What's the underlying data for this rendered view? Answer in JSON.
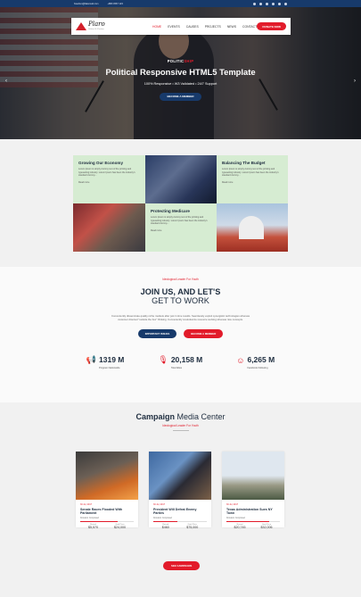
{
  "topbar": {
    "email": "freedom@fakemail.com",
    "phone": "+880 4567 123",
    "social_icons": [
      "facebook-icon",
      "twitter-icon",
      "google-plus-icon",
      "linkedin-icon",
      "instagram-icon",
      "youtube-icon"
    ]
  },
  "nav": {
    "logo": "Plaro",
    "logo_tagline": "Political & Election",
    "items": [
      "HOME",
      "EVENTS",
      "CAUSES",
      "PROJECTS",
      "NEWS",
      "CONTACT"
    ],
    "donate": "DONATE NOW"
  },
  "hero": {
    "kicker_part1": "POLITIC",
    "kicker_part2": "SHIP",
    "title": "Political Responsive HTML5 Template",
    "subtitle": "100% Responsive • W3 Validated • 24/7 Support",
    "cta": "BECOME A MEMBER"
  },
  "features": [
    {
      "title": "Growing Our Economy",
      "text": "Lorem Ipsum is simply dummy text of the printing and typesetting industry. Lorem Ipsum has been the industry's standard dummy...",
      "more": "Read more"
    },
    {
      "title": "Balancing The Budget",
      "text": "Lorem Ipsum is simply dummy text of the printing and typesetting industry. Lorem Ipsum has been the industry's standard dummy...",
      "more": "Read more"
    },
    {
      "title": "Protecting Medicare",
      "text": "Lorem Ipsum is simply dummy text of the printing and typesetting industry. Lorem Ipsum has been the industry's standard dummy...",
      "more": "Read more"
    }
  ],
  "join": {
    "kicker": "Ideological Leader For Youth",
    "title_bold": "JOIN US, AND LET'S",
    "title_light": "GET TO WORK",
    "text": "Conveniently disseminate quality niche markets after just in time results. Seamlessly exploit synergistic technologies whereas customer directed \"outside the box\" thinking. Conveniently revolutionize resource sucking whereas nice concepts.",
    "btn1": "IMPORTANT ISSUES",
    "btn2": "BECOME A MEMBER",
    "stats": [
      {
        "icon": "megaphone-icon",
        "value": "1319 M",
        "label": "Program Nationwide"
      },
      {
        "icon": "microphone-icon",
        "value": "20,158 M",
        "label": "Total Allies"
      },
      {
        "icon": "smile-icon",
        "value": "6,265 M",
        "label": "Facebook Following"
      }
    ]
  },
  "media": {
    "title_bold": "Campaign",
    "title_light": " Media Center",
    "kicker": "Ideological Leader For Youth",
    "cards": [
      {
        "date": "30 Jul, 2017",
        "title": "Senate Races Flooded With Parliament",
        "goal": "Donation Completed",
        "progress": 0.7,
        "raised_label": "Raised",
        "raised": "$5,570",
        "goal_label": "Goal Price",
        "goal_value": "$24,000"
      },
      {
        "date": "30 Jul, 2017",
        "title": "President Will Defeat Enemy Parties",
        "goal": "Donation Completed",
        "progress": 0.45,
        "raised_label": "Raised",
        "raised": "$460",
        "goal_label": "Goal Price",
        "goal_value": "$75,000"
      },
      {
        "date": "30 Jul, 2017",
        "title": "Texas Administration Sues NY Town",
        "goal": "Donation Completed",
        "progress": 0.8,
        "raised_label": "Raised",
        "raised": "$20,745",
        "goal_label": "Goal Price",
        "goal_value": "$32,006"
      }
    ],
    "see_all": "SEE CAMPAIGNS"
  }
}
